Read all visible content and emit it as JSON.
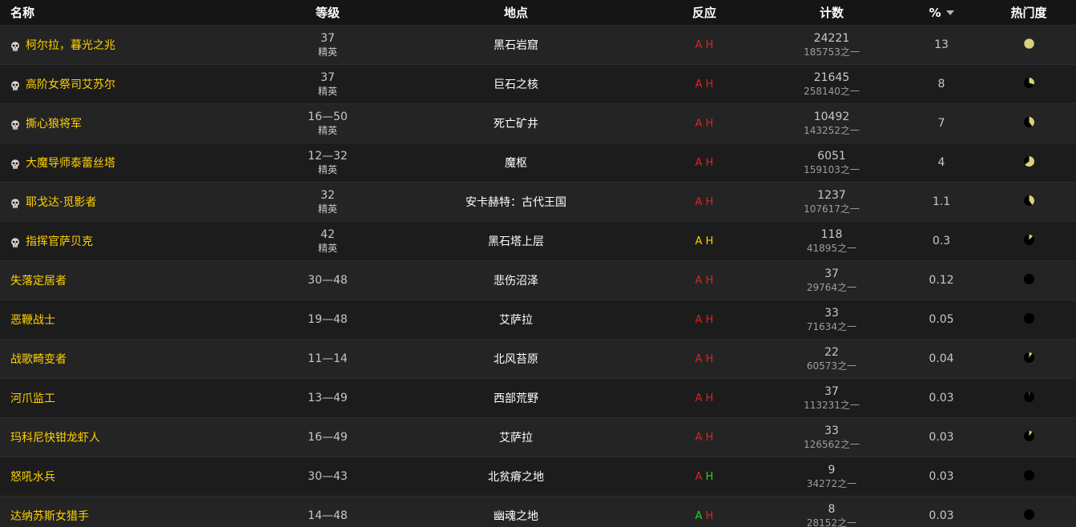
{
  "headers": {
    "name": "名称",
    "level": "等级",
    "location": "地点",
    "reaction": "反应",
    "count": "计数",
    "percent": "%",
    "popularity": "热门度"
  },
  "colors": {
    "name_link": "#ffd100",
    "hostile": "#e0221e",
    "neutral": "#ffd100",
    "friendly": "#22d722",
    "pie_fill": "#d8d27a",
    "pie_bg": "#000000"
  },
  "rows": [
    {
      "name": "柯尔拉，暮光之兆",
      "boss": true,
      "level": "37",
      "classification": "精英",
      "location": "黑石岩窟",
      "reaction_a": "A",
      "reaction_h": "H",
      "a_color": "hostile",
      "h_color": "hostile",
      "count": "24221",
      "count_of": "185753之一",
      "percent": "13",
      "popularity": 1.0
    },
    {
      "name": "高阶女祭司艾苏尔",
      "boss": true,
      "level": "37",
      "classification": "精英",
      "location": "巨石之核",
      "reaction_a": "A",
      "reaction_h": "H",
      "a_color": "hostile",
      "h_color": "hostile",
      "count": "21645",
      "count_of": "258140之一",
      "percent": "8",
      "popularity": 0.3
    },
    {
      "name": "撕心狼将军",
      "boss": true,
      "level": "16—50",
      "classification": "精英",
      "location": "死亡矿井",
      "reaction_a": "A",
      "reaction_h": "H",
      "a_color": "hostile",
      "h_color": "hostile",
      "count": "10492",
      "count_of": "143252之一",
      "percent": "7",
      "popularity": 0.4
    },
    {
      "name": "大魔导师泰蕾丝塔",
      "boss": true,
      "level": "12—32",
      "classification": "精英",
      "location": "魔枢",
      "reaction_a": "A",
      "reaction_h": "H",
      "a_color": "hostile",
      "h_color": "hostile",
      "count": "6051",
      "count_of": "159103之一",
      "percent": "4",
      "popularity": 0.65
    },
    {
      "name": "耶戈达·觅影者",
      "boss": true,
      "level": "32",
      "classification": "精英",
      "location": "安卡赫特：古代王国",
      "reaction_a": "A",
      "reaction_h": "H",
      "a_color": "hostile",
      "h_color": "hostile",
      "count": "1237",
      "count_of": "107617之一",
      "percent": "1.1",
      "popularity": 0.4
    },
    {
      "name": "指挥官萨贝克",
      "boss": true,
      "level": "42",
      "classification": "精英",
      "location": "黑石塔上层",
      "reaction_a": "A",
      "reaction_h": "H",
      "a_color": "neutral",
      "h_color": "neutral",
      "count": "118",
      "count_of": "41895之一",
      "percent": "0.3",
      "popularity": 0.12
    },
    {
      "name": "失落定居者",
      "boss": false,
      "level": "30—48",
      "classification": "",
      "location": "悲伤沼泽",
      "reaction_a": "A",
      "reaction_h": "H",
      "a_color": "hostile",
      "h_color": "hostile",
      "count": "37",
      "count_of": "29764之一",
      "percent": "0.12",
      "popularity": 0.0
    },
    {
      "name": "恶鞭战士",
      "boss": false,
      "level": "19—48",
      "classification": "",
      "location": "艾萨拉",
      "reaction_a": "A",
      "reaction_h": "H",
      "a_color": "hostile",
      "h_color": "hostile",
      "count": "33",
      "count_of": "71634之一",
      "percent": "0.05",
      "popularity": 0.0
    },
    {
      "name": "战歌畸变者",
      "boss": false,
      "level": "11—14",
      "classification": "",
      "location": "北风苔原",
      "reaction_a": "A",
      "reaction_h": "H",
      "a_color": "hostile",
      "h_color": "hostile",
      "count": "22",
      "count_of": "60573之一",
      "percent": "0.04",
      "popularity": 0.1
    },
    {
      "name": "河爪监工",
      "boss": false,
      "level": "13—49",
      "classification": "",
      "location": "西部荒野",
      "reaction_a": "A",
      "reaction_h": "H",
      "a_color": "hostile",
      "h_color": "hostile",
      "count": "37",
      "count_of": "113231之一",
      "percent": "0.03",
      "popularity": 0.02
    },
    {
      "name": "玛科尼快钳龙虾人",
      "boss": false,
      "level": "16—49",
      "classification": "",
      "location": "艾萨拉",
      "reaction_a": "A",
      "reaction_h": "H",
      "a_color": "hostile",
      "h_color": "hostile",
      "count": "33",
      "count_of": "126562之一",
      "percent": "0.03",
      "popularity": 0.1
    },
    {
      "name": "怒吼水兵",
      "boss": false,
      "level": "30—43",
      "classification": "",
      "location": "北贫瘠之地",
      "reaction_a": "A",
      "reaction_h": "H",
      "a_color": "hostile",
      "h_color": "friendly",
      "count": "9",
      "count_of": "34272之一",
      "percent": "0.03",
      "popularity": 0.0
    },
    {
      "name": "达纳苏斯女猎手",
      "boss": false,
      "level": "14—48",
      "classification": "",
      "location": "幽魂之地",
      "reaction_a": "A",
      "reaction_h": "H",
      "a_color": "friendly",
      "h_color": "hostile",
      "count": "8",
      "count_of": "28152之一",
      "percent": "0.03",
      "popularity": 0.0
    }
  ]
}
